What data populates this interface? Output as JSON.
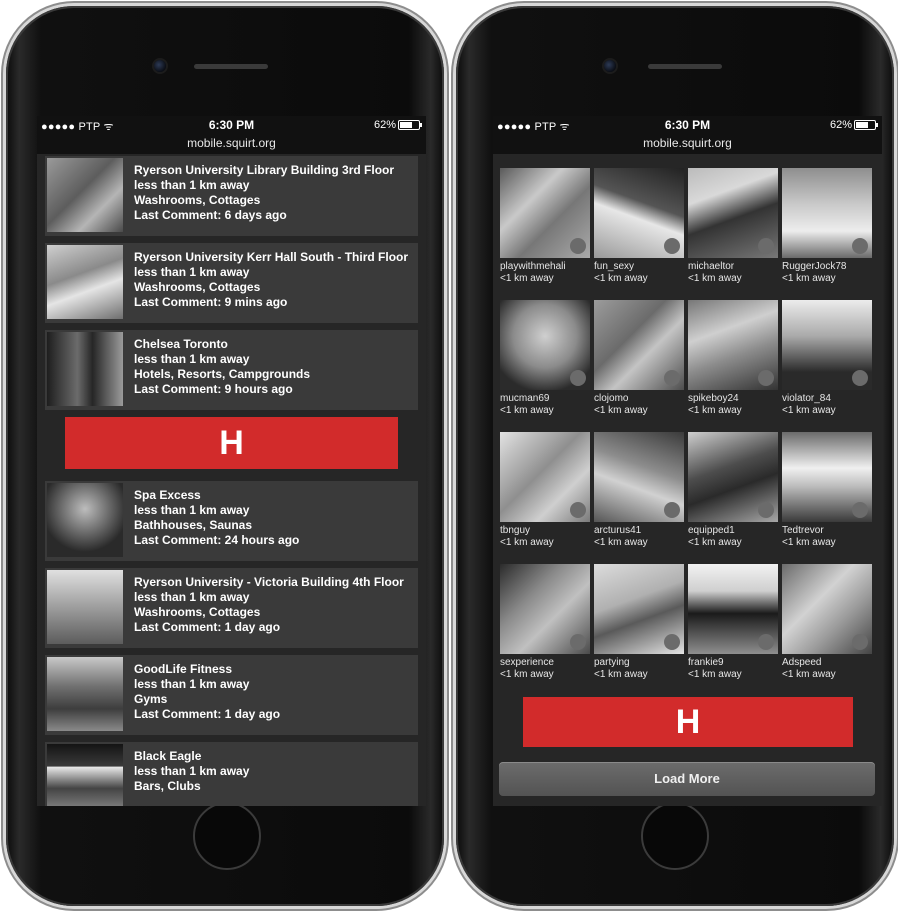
{
  "status": {
    "carrier": "●●●●● PTP ᯤ",
    "time": "6:30 PM",
    "battery": "62%"
  },
  "url": "mobile.squirt.org",
  "ad_label": "H",
  "places": [
    {
      "name": "Ryerson University Library Building 3rd Floor",
      "distance": "less than 1 km away",
      "category": "Washrooms, Cottages",
      "last_comment": "Last Comment: 6 days ago"
    },
    {
      "name": "Ryerson University Kerr Hall South - Third Floor",
      "distance": "less than 1 km away",
      "category": "Washrooms, Cottages",
      "last_comment": "Last Comment: 9 mins ago"
    },
    {
      "name": "Chelsea Toronto",
      "distance": "less than 1 km away",
      "category": "Hotels, Resorts, Campgrounds",
      "last_comment": "Last Comment: 9 hours ago"
    },
    {
      "name": "Spa Excess",
      "distance": "less than 1 km away",
      "category": "Bathhouses, Saunas",
      "last_comment": "Last Comment: 24 hours ago"
    },
    {
      "name": "Ryerson University - Victoria Building 4th Floor",
      "distance": "less than 1 km away",
      "category": "Washrooms, Cottages",
      "last_comment": "Last Comment: 1 day ago"
    },
    {
      "name": "GoodLife Fitness",
      "distance": "less than 1 km away",
      "category": "Gyms",
      "last_comment": "Last Comment: 1 day ago"
    },
    {
      "name": "Black Eagle",
      "distance": "less than 1 km away",
      "category": "Bars, Clubs",
      "last_comment": ""
    }
  ],
  "users": [
    {
      "name": "playwithmehali",
      "distance": "<1 km away"
    },
    {
      "name": "fun_sexy",
      "distance": "<1 km away"
    },
    {
      "name": "michaeltor",
      "distance": "<1 km away"
    },
    {
      "name": "RuggerJock78",
      "distance": "<1 km away"
    },
    {
      "name": "mucman69",
      "distance": "<1 km away"
    },
    {
      "name": "clojomo",
      "distance": "<1 km away"
    },
    {
      "name": "spikeboy24",
      "distance": "<1 km away"
    },
    {
      "name": "violator_84",
      "distance": "<1 km away"
    },
    {
      "name": "tbnguy",
      "distance": "<1 km away"
    },
    {
      "name": "arcturus41",
      "distance": "<1 km away"
    },
    {
      "name": "equipped1",
      "distance": "<1 km away"
    },
    {
      "name": "Tedtrevor",
      "distance": "<1 km away"
    },
    {
      "name": "sexperience",
      "distance": "<1 km away"
    },
    {
      "name": "partying",
      "distance": "<1 km away"
    },
    {
      "name": "frankie9",
      "distance": "<1 km away"
    },
    {
      "name": "Adspeed",
      "distance": "<1 km away"
    }
  ],
  "load_more": "Load More",
  "colors": {
    "ad_red": "#d22b2b",
    "screen_bg": "#262626",
    "card_bg": "#3a3a3a"
  }
}
